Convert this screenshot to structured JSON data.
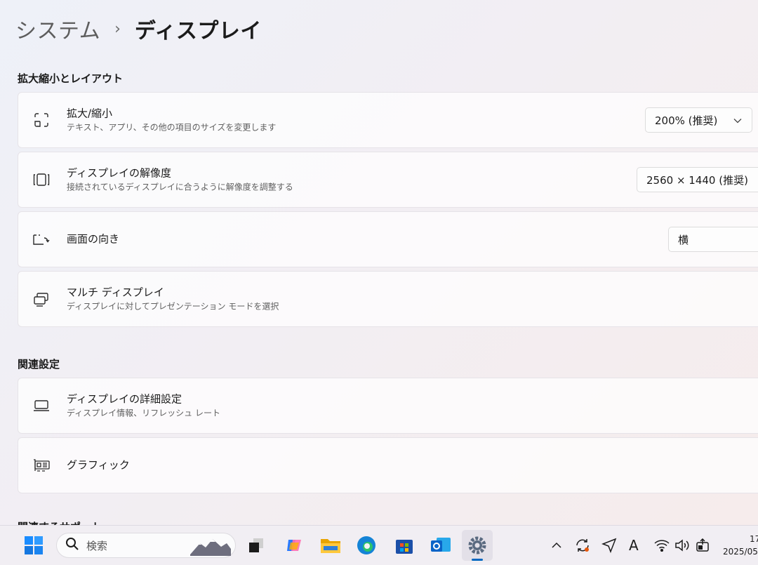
{
  "breadcrumb": {
    "parent": "システム",
    "separator": "›",
    "current": "ディスプレイ"
  },
  "sections": {
    "scale_layout": {
      "title": "拡大縮小とレイアウト",
      "scale": {
        "title": "拡大/縮小",
        "subtitle": "テキスト、アプリ、その他の項目のサイズを変更します",
        "value": "200% (推奨)"
      },
      "resolution": {
        "title": "ディスプレイの解像度",
        "subtitle": "接続されているディスプレイに合うように解像度を調整する",
        "value": "2560 × 1440 (推奨)"
      },
      "orientation": {
        "title": "画面の向き",
        "value": "横"
      },
      "multi": {
        "title": "マルチ ディスプレイ",
        "subtitle": "ディスプレイに対してプレゼンテーション モードを選択"
      }
    },
    "related": {
      "title": "関連設定",
      "advanced": {
        "title": "ディスプレイの詳細設定",
        "subtitle": "ディスプレイ情報、リフレッシュ レート"
      },
      "graphics": {
        "title": "グラフィック"
      }
    },
    "next_title": "関連するサポート"
  },
  "taskbar": {
    "search_placeholder": "検索",
    "clock_time": "17",
    "clock_date": "2025/05"
  },
  "colors": {
    "accent": "#0067c0",
    "background": "#f2eef3"
  }
}
